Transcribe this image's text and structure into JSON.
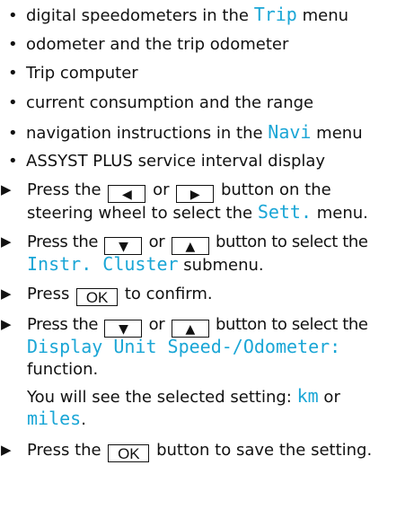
{
  "colors": {
    "display_text": "#1aa6d6",
    "text": "#111111"
  },
  "icons": {
    "step_arrow": "▶",
    "left_key": "◀",
    "right_key": "▶",
    "down_key": "▼",
    "up_key": "▲"
  },
  "bullets": {
    "dot": "•",
    "item1_a": "digital speedometers in the ",
    "item1_disp": "Trip",
    "item1_b": " menu",
    "item2": "odometer and the trip odometer",
    "item3": "Trip computer",
    "item4": "current consumption and the range",
    "item5_a": "navigation instructions in the ",
    "item5_disp": "Navi",
    "item5_b": " menu",
    "item6": "ASSYST PLUS service interval display"
  },
  "step1": {
    "a": "Press the ",
    "or": " or ",
    "b": " button on the",
    "c": "steering wheel to select the ",
    "disp": "Sett.",
    "d": " menu."
  },
  "step2": {
    "a": "Press the ",
    "or": " or ",
    "b": " button to select the",
    "disp": "Instr. Cluster",
    "c": " submenu."
  },
  "step3": {
    "a": "Press ",
    "key": "OK",
    "b": " to confirm."
  },
  "step4": {
    "a": "Press the ",
    "or": " or ",
    "b": " button to select the",
    "disp": "Display Unit Speed-/Odometer:",
    "c": "function.",
    "d": "You will see the selected setting: ",
    "disp_km": "km",
    "e": " or",
    "disp_miles": "miles",
    "f": "."
  },
  "step5": {
    "a": "Press the ",
    "key": "OK",
    "b": " button to save the setting."
  }
}
